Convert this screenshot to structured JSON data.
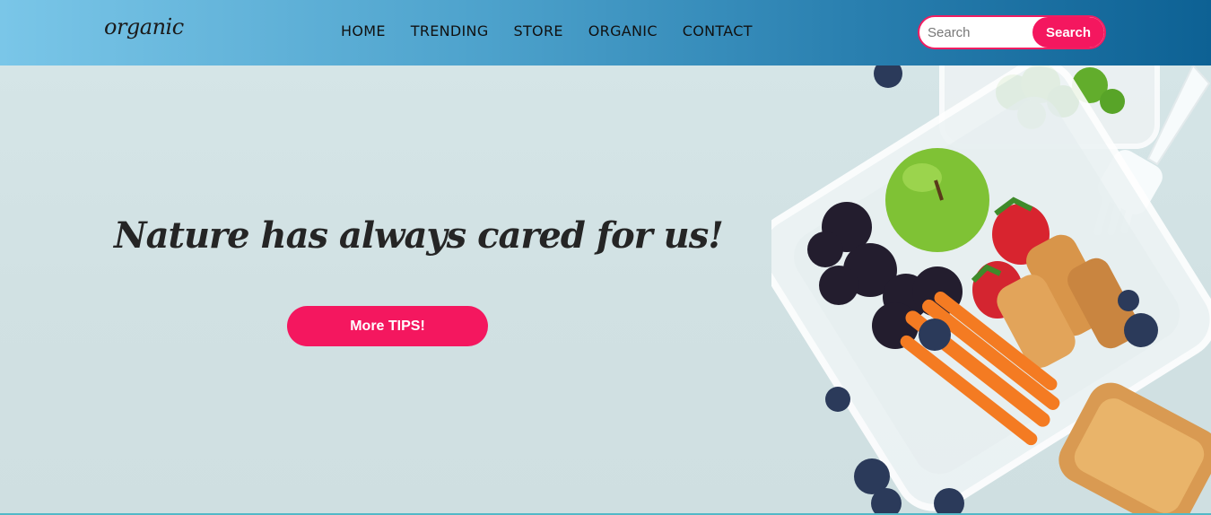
{
  "brand": {
    "name": "organic"
  },
  "nav": {
    "links": [
      "HOME",
      "TRENDING",
      "STORE",
      "ORGANIC",
      "CONTACT"
    ]
  },
  "search": {
    "placeholder": "Search",
    "value": "",
    "button_label": "Search"
  },
  "hero": {
    "headline": "Nature has always cared for us!",
    "cta_label": "More TIPS!",
    "image_icon": "lunchbox-with-fruit-image"
  },
  "colors": {
    "accent": "#f4175f",
    "nav_gradient_start": "#7ac6e8",
    "nav_gradient_end": "#0d6194",
    "hero_background": "#d5e5e7"
  }
}
